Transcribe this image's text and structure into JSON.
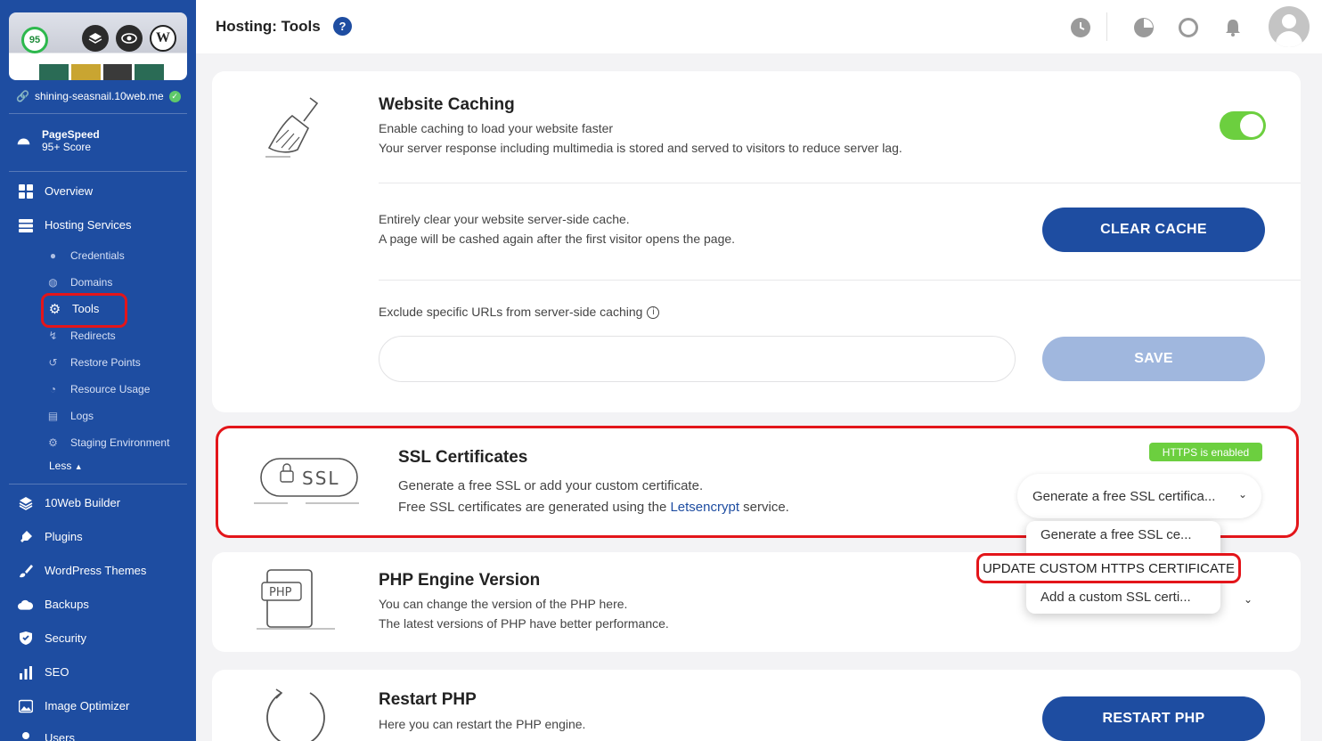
{
  "sidebar": {
    "thumbnail": {
      "score": "95"
    },
    "site_url": "shining-seasnail.10web.me",
    "pagespeed": {
      "title": "PageSpeed",
      "score": "95+ Score"
    },
    "nav": [
      {
        "label": "Overview",
        "icon": "grid-icon"
      },
      {
        "label": "Hosting Services",
        "icon": "server-icon"
      }
    ],
    "hosting_sub": [
      {
        "label": "Credentials",
        "icon": "info-icon"
      },
      {
        "label": "Domains",
        "icon": "globe-icon"
      },
      {
        "label": "Tools",
        "icon": "gear-icon"
      },
      {
        "label": "Redirects",
        "icon": "redirect-icon"
      },
      {
        "label": "Restore Points",
        "icon": "restore-icon"
      },
      {
        "label": "Resource Usage",
        "icon": "gauge-icon"
      },
      {
        "label": "Logs",
        "icon": "document-icon"
      },
      {
        "label": "Staging Environment",
        "icon": "cog-icon"
      }
    ],
    "less_label": "Less",
    "nav2": [
      {
        "label": "10Web Builder",
        "icon": "layers-icon"
      },
      {
        "label": "Plugins",
        "icon": "plugin-icon"
      },
      {
        "label": "WordPress Themes",
        "icon": "brush-icon"
      },
      {
        "label": "Backups",
        "icon": "cloud-icon"
      },
      {
        "label": "Security",
        "icon": "shield-icon"
      },
      {
        "label": "SEO",
        "icon": "bar-chart-icon"
      },
      {
        "label": "Image Optimizer",
        "icon": "image-icon"
      },
      {
        "label": "Users",
        "icon": "users-icon"
      }
    ]
  },
  "header": {
    "title": "Hosting: Tools",
    "help": "?"
  },
  "caching": {
    "title": "Website Caching",
    "desc1": "Enable caching to load your website faster",
    "desc2": "Your server response including multimedia is stored and served to visitors to reduce server lag.",
    "toggle_on": true,
    "clear_desc1": "Entirely clear your website server-side cache.",
    "clear_desc2": "A page will be cashed again after the first visitor opens the page.",
    "clear_button": "CLEAR CACHE",
    "exclude_label": "Exclude specific URLs from server-side caching",
    "exclude_value": "",
    "save_button": "SAVE"
  },
  "ssl": {
    "title": "SSL Certificates",
    "desc1": "Generate a free SSL or add your custom certificate.",
    "desc2_pre": "Free SSL certificates are generated using the ",
    "desc2_link": "Letsencrypt",
    "desc2_post": " service.",
    "badge": "HTTPS is enabled",
    "selected": "Generate a free SSL certifica...",
    "illus_label": "SSL",
    "options": [
      "Generate a free SSL ce...",
      "UPDATE CUSTOM HTTPS CERTIFICATE",
      "Add a custom SSL certi..."
    ]
  },
  "php": {
    "title": "PHP Engine Version",
    "desc1": "You can change the version of the PHP here.",
    "desc2": "The latest versions of PHP have better performance.",
    "illus_label": "PHP"
  },
  "restart": {
    "title": "Restart PHP",
    "desc1": "Here you can restart the PHP engine.",
    "button": "RESTART PHP"
  },
  "colors": {
    "sidebar": "#1e4da1",
    "accent": "#1e4da1",
    "highlight": "#e3151a",
    "success": "#6ccf3f"
  }
}
